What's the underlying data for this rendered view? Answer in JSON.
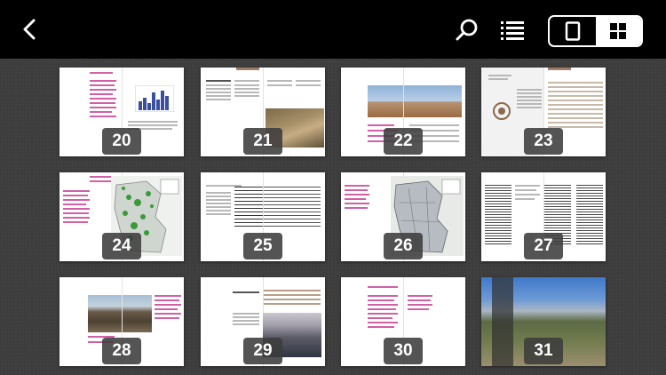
{
  "toolbar": {
    "back_icon": "chevron-left-icon",
    "search_icon": "search-icon",
    "list_icon": "list-icon",
    "view_modes": [
      {
        "name": "single-page-view",
        "icon": "single-page-icon",
        "active": false
      },
      {
        "name": "grid-view",
        "icon": "grid-icon",
        "active": true
      }
    ]
  },
  "pages": [
    {
      "label": "20"
    },
    {
      "label": "21"
    },
    {
      "label": "22"
    },
    {
      "label": "23"
    },
    {
      "label": "24"
    },
    {
      "label": "25"
    },
    {
      "label": "26"
    },
    {
      "label": "27"
    },
    {
      "label": "28"
    },
    {
      "label": "29"
    },
    {
      "label": "30"
    },
    {
      "label": "31"
    }
  ],
  "colors": {
    "toolbar_bg": "#000000",
    "background": "#3d3d3d",
    "accent_text": "#d35fa6",
    "badge_bg": "#3c3c3c"
  }
}
